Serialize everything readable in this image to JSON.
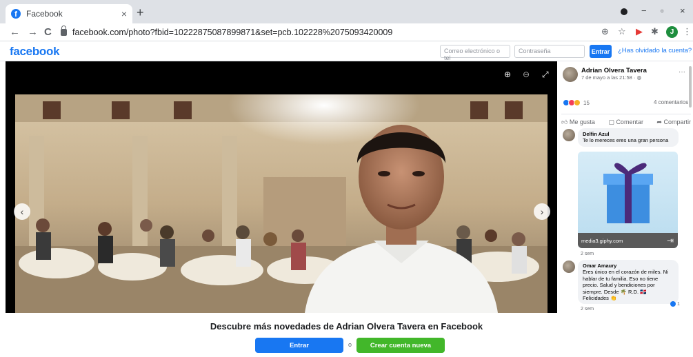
{
  "browser": {
    "tab_title": "Facebook",
    "tab_close": "×",
    "new_tab": "+",
    "url": "facebook.com/photo?fbid=10222875087899871&set=pcb.102228%2075093420009",
    "nav": {
      "back": "←",
      "forward": "→",
      "reload": "C"
    },
    "window": {
      "minimize": "−",
      "restore": "▫",
      "close": "×"
    },
    "profile_initial": "J"
  },
  "header": {
    "logo": "facebook",
    "email_placeholder": "Correo electrónico o tel",
    "password_placeholder": "Contraseña",
    "login_button": "Entrar",
    "forgot_link": "¿Has olvidado la cuenta?"
  },
  "viewer": {
    "zoom_in_icon": "⊕",
    "zoom_out_icon": "⊖",
    "fullscreen_icon": "⤢",
    "prev_icon": "‹",
    "next_icon": "›"
  },
  "post": {
    "author": "Adrian Olvera Tavera",
    "timestamp": "7 de mayo a las 21:58 · ",
    "more": "···",
    "reaction_count": "15",
    "comments_count": "4 comentarios",
    "actions": {
      "like": "Me gusta",
      "comment": "Comentar",
      "share": "Compartir"
    }
  },
  "comments": [
    {
      "name": "Delfin Azul",
      "text": "Te lo mereces eres una gran persona",
      "gif_source": "media3.giphy.com",
      "time": "2 sem"
    },
    {
      "name": "Omar Amaury",
      "text": "Eres único en el corazón de miles. Ni hablar de tu familia. Eso no tiene precio. Salud y bendiciones por siempre. Desde 🌴 R.D. 🇩🇴 Felicidades 👏",
      "time": "2 sem",
      "likes": "1"
    }
  ],
  "cta": {
    "title": "Descubre más novedades de Adrian Olvera Tavera en Facebook",
    "login": "Entrar",
    "or": "o",
    "signup": "Crear cuenta nueva"
  },
  "colors": {
    "brand_blue": "#1877f2",
    "signup_green": "#42b72a"
  }
}
